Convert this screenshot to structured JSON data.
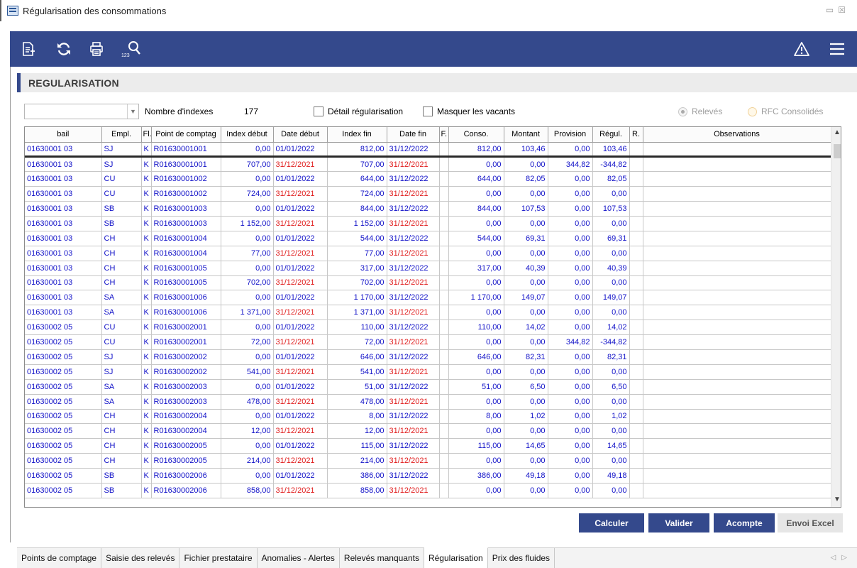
{
  "window": {
    "title": "Régularisation des consommations"
  },
  "toolbar": {
    "left_icons": [
      "export-icon",
      "refresh-icon",
      "print-icon",
      "search-index-icon"
    ],
    "right_icons": [
      "warning-icon",
      "menu-icon"
    ]
  },
  "section": {
    "title": "REGULARISATION"
  },
  "filters": {
    "combo_value": "",
    "nb_label": "Nombre d'indexes",
    "nb_value": "177",
    "detail_label": "Détail régularisation",
    "masquer_label": "Masquer les vacants",
    "releves_label": "Relevés",
    "rfc_label": "RFC Consolidés"
  },
  "grid": {
    "columns": [
      "bail",
      "Empl.",
      "Fl.",
      "Point de comptag",
      "Index début",
      "Date début",
      "Index fin",
      "Date fin",
      "F.",
      "Conso.",
      "Montant",
      "Provision",
      "Régul.",
      "R.",
      "Observations"
    ],
    "rows": [
      [
        "01630001 03",
        "SJ",
        "K",
        "R01630001001",
        "0,00",
        "01/01/2022",
        "812,00",
        "31/12/2022",
        "",
        "812,00",
        "103,46",
        "0,00",
        "103,46",
        "",
        ""
      ],
      [
        "01630001 03",
        "SJ",
        "K",
        "R01630001001",
        "707,00",
        "31/12/2021",
        "707,00",
        "31/12/2021",
        "",
        "0,00",
        "0,00",
        "344,82",
        "-344,82",
        "",
        ""
      ],
      [
        "01630001 03",
        "CU",
        "K",
        "R01630001002",
        "0,00",
        "01/01/2022",
        "644,00",
        "31/12/2022",
        "",
        "644,00",
        "82,05",
        "0,00",
        "82,05",
        "",
        ""
      ],
      [
        "01630001 03",
        "CU",
        "K",
        "R01630001002",
        "724,00",
        "31/12/2021",
        "724,00",
        "31/12/2021",
        "",
        "0,00",
        "0,00",
        "0,00",
        "0,00",
        "",
        ""
      ],
      [
        "01630001 03",
        "SB",
        "K",
        "R01630001003",
        "0,00",
        "01/01/2022",
        "844,00",
        "31/12/2022",
        "",
        "844,00",
        "107,53",
        "0,00",
        "107,53",
        "",
        ""
      ],
      [
        "01630001 03",
        "SB",
        "K",
        "R01630001003",
        "1 152,00",
        "31/12/2021",
        "1 152,00",
        "31/12/2021",
        "",
        "0,00",
        "0,00",
        "0,00",
        "0,00",
        "",
        ""
      ],
      [
        "01630001 03",
        "CH",
        "K",
        "R01630001004",
        "0,00",
        "01/01/2022",
        "544,00",
        "31/12/2022",
        "",
        "544,00",
        "69,31",
        "0,00",
        "69,31",
        "",
        ""
      ],
      [
        "01630001 03",
        "CH",
        "K",
        "R01630001004",
        "77,00",
        "31/12/2021",
        "77,00",
        "31/12/2021",
        "",
        "0,00",
        "0,00",
        "0,00",
        "0,00",
        "",
        ""
      ],
      [
        "01630001 03",
        "CH",
        "K",
        "R01630001005",
        "0,00",
        "01/01/2022",
        "317,00",
        "31/12/2022",
        "",
        "317,00",
        "40,39",
        "0,00",
        "40,39",
        "",
        ""
      ],
      [
        "01630001 03",
        "CH",
        "K",
        "R01630001005",
        "702,00",
        "31/12/2021",
        "702,00",
        "31/12/2021",
        "",
        "0,00",
        "0,00",
        "0,00",
        "0,00",
        "",
        ""
      ],
      [
        "01630001 03",
        "SA",
        "K",
        "R01630001006",
        "0,00",
        "01/01/2022",
        "1 170,00",
        "31/12/2022",
        "",
        "1 170,00",
        "149,07",
        "0,00",
        "149,07",
        "",
        ""
      ],
      [
        "01630001 03",
        "SA",
        "K",
        "R01630001006",
        "1 371,00",
        "31/12/2021",
        "1 371,00",
        "31/12/2021",
        "",
        "0,00",
        "0,00",
        "0,00",
        "0,00",
        "",
        ""
      ],
      [
        "01630002 05",
        "CU",
        "K",
        "R01630002001",
        "0,00",
        "01/01/2022",
        "110,00",
        "31/12/2022",
        "",
        "110,00",
        "14,02",
        "0,00",
        "14,02",
        "",
        ""
      ],
      [
        "01630002 05",
        "CU",
        "K",
        "R01630002001",
        "72,00",
        "31/12/2021",
        "72,00",
        "31/12/2021",
        "",
        "0,00",
        "0,00",
        "344,82",
        "-344,82",
        "",
        ""
      ],
      [
        "01630002 05",
        "SJ",
        "K",
        "R01630002002",
        "0,00",
        "01/01/2022",
        "646,00",
        "31/12/2022",
        "",
        "646,00",
        "82,31",
        "0,00",
        "82,31",
        "",
        ""
      ],
      [
        "01630002 05",
        "SJ",
        "K",
        "R01630002002",
        "541,00",
        "31/12/2021",
        "541,00",
        "31/12/2021",
        "",
        "0,00",
        "0,00",
        "0,00",
        "0,00",
        "",
        ""
      ],
      [
        "01630002 05",
        "SA",
        "K",
        "R01630002003",
        "0,00",
        "01/01/2022",
        "51,00",
        "31/12/2022",
        "",
        "51,00",
        "6,50",
        "0,00",
        "6,50",
        "",
        ""
      ],
      [
        "01630002 05",
        "SA",
        "K",
        "R01630002003",
        "478,00",
        "31/12/2021",
        "478,00",
        "31/12/2021",
        "",
        "0,00",
        "0,00",
        "0,00",
        "0,00",
        "",
        ""
      ],
      [
        "01630002 05",
        "CH",
        "K",
        "R01630002004",
        "0,00",
        "01/01/2022",
        "8,00",
        "31/12/2022",
        "",
        "8,00",
        "1,02",
        "0,00",
        "1,02",
        "",
        ""
      ],
      [
        "01630002 05",
        "CH",
        "K",
        "R01630002004",
        "12,00",
        "31/12/2021",
        "12,00",
        "31/12/2021",
        "",
        "0,00",
        "0,00",
        "0,00",
        "0,00",
        "",
        ""
      ],
      [
        "01630002 05",
        "CH",
        "K",
        "R01630002005",
        "0,00",
        "01/01/2022",
        "115,00",
        "31/12/2022",
        "",
        "115,00",
        "14,65",
        "0,00",
        "14,65",
        "",
        ""
      ],
      [
        "01630002 05",
        "CH",
        "K",
        "R01630002005",
        "214,00",
        "31/12/2021",
        "214,00",
        "31/12/2021",
        "",
        "0,00",
        "0,00",
        "0,00",
        "0,00",
        "",
        ""
      ],
      [
        "01630002 05",
        "SB",
        "K",
        "R01630002006",
        "0,00",
        "01/01/2022",
        "386,00",
        "31/12/2022",
        "",
        "386,00",
        "49,18",
        "0,00",
        "49,18",
        "",
        ""
      ],
      [
        "01630002 05",
        "SB",
        "K",
        "R01630002006",
        "858,00",
        "31/12/2021",
        "858,00",
        "31/12/2021",
        "",
        "0,00",
        "0,00",
        "0,00",
        "0,00",
        "",
        ""
      ]
    ]
  },
  "actions": {
    "calculer": "Calculer",
    "valider": "Valider",
    "acompte": "Acompte",
    "envoi_excel": "Envoi Excel"
  },
  "tabs": [
    "Points de comptage",
    "Saisie des relevés",
    "Fichier prestataire",
    "Anomalies - Alertes",
    "Relevés manquants",
    "Régularisation",
    "Prix des fluides"
  ],
  "active_tab": "Régularisation",
  "colors": {
    "toolbar": "#34498c",
    "text_blue": "#1212c8",
    "text_red": "#e01b1b"
  }
}
